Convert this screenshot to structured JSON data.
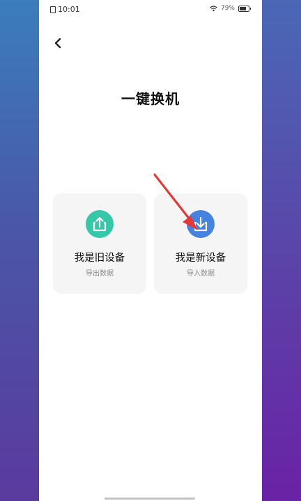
{
  "status_bar": {
    "time": "10:01",
    "battery_percent": "79%",
    "battery_level": 0.79,
    "icons": [
      "file-icon",
      "wifi-icon",
      "battery-icon"
    ]
  },
  "header": {
    "back_icon": "chevron-left-icon",
    "title": "一键换机"
  },
  "options": [
    {
      "label": "我是旧设备",
      "sublabel": "导出数据",
      "icon": "upload-icon",
      "icon_color": "#35c8a8"
    },
    {
      "label": "我是新设备",
      "sublabel": "导入数据",
      "icon": "download-icon",
      "icon_color": "#4682e0"
    }
  ],
  "annotation": {
    "icon": "red-arrow-icon",
    "color": "#e53935"
  }
}
